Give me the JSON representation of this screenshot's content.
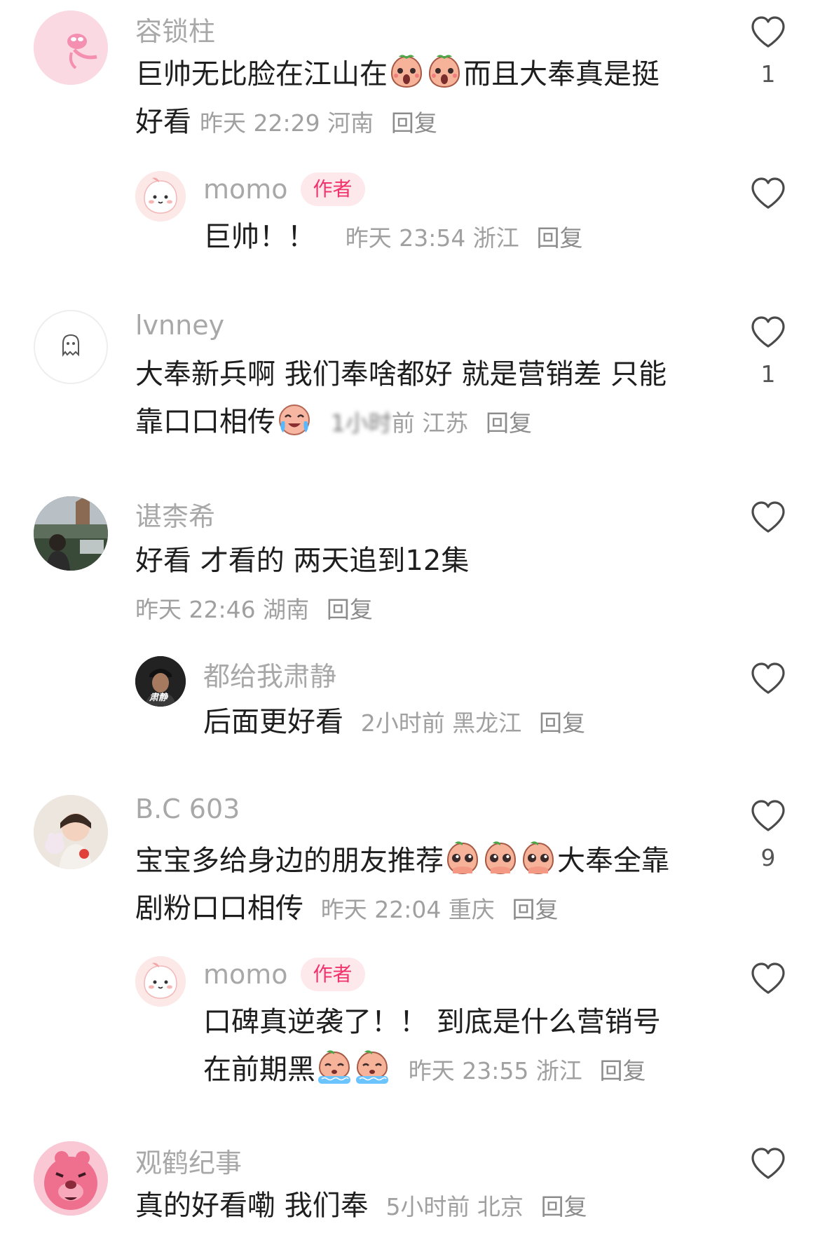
{
  "comments": [
    {
      "name": "容锁柱",
      "text1": "巨帅无比脸在江山在",
      "text2": "而且大奉真是挺",
      "text3": "好看",
      "meta": "昨天 22:29 河南",
      "reply": "回复",
      "likes": "1"
    },
    {
      "name": "momo",
      "badge": "作者",
      "text": "巨帅！！",
      "meta": "昨天 23:54 浙江",
      "reply": "回复"
    },
    {
      "name": "lvnney",
      "text1": "大奉新兵啊 我们奉啥都好 就是营销差 只能",
      "text2": "靠口口相传",
      "meta_blurred": "1小时",
      "meta": "前 江苏",
      "reply": "回复",
      "likes": "1"
    },
    {
      "name": "谌柰希",
      "text": "好看 才看的 两天追到12集",
      "meta": "昨天 22:46 湖南",
      "reply": "回复"
    },
    {
      "name": "都给我肃静",
      "avatar_text": "肃静",
      "text": "后面更好看",
      "meta": "2小时前 黑龙江",
      "reply": "回复"
    },
    {
      "name": "B.C 603",
      "text1": "宝宝多给身边的朋友推荐",
      "text2": "大奉全靠",
      "text3": "剧粉口口相传",
      "meta": "昨天 22:04 重庆",
      "reply": "回复",
      "likes": "9"
    },
    {
      "name": "momo",
      "badge": "作者",
      "text1": "口碑真逆袭了！！ 到底是什么营销号",
      "text2": "在前期黑",
      "meta": "昨天 23:55 浙江",
      "reply": "回复"
    },
    {
      "name": "观鹤纪事",
      "text": "真的好看嘞 我们奉",
      "meta": "5小时前 北京",
      "reply": "回复"
    }
  ],
  "icons": {
    "like": "heart-outline-icon",
    "emoji_shock": "shocked-peach-emoji",
    "emoji_cry": "crying-laugh-emoji",
    "emoji_plead": "pleading-peach-emoji",
    "emoji_tears": "tearful-peach-emoji"
  },
  "colors": {
    "badge_bg": "#fde8ec",
    "badge_text": "#f0346b",
    "name": "#a8a8a8",
    "meta": "#a0a0a0"
  }
}
